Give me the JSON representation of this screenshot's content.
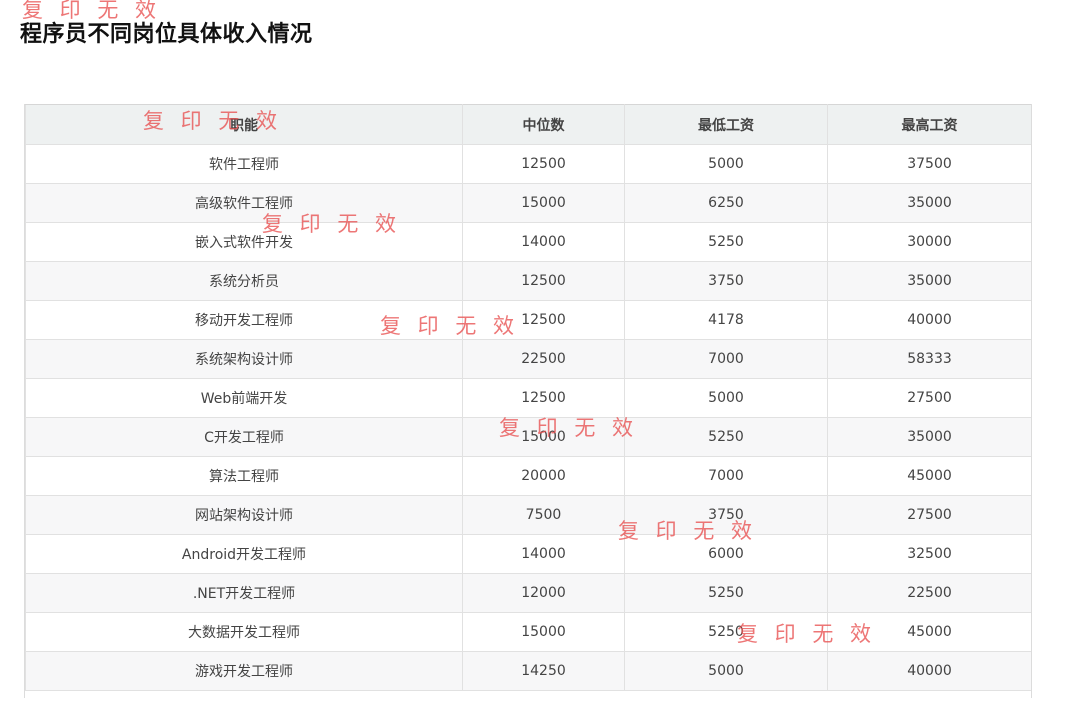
{
  "title": "程序员不同岗位具体收入情况",
  "watermark": "复 印 无 效",
  "table": {
    "headers": [
      "职能",
      "中位数",
      "最低工资",
      "最高工资"
    ],
    "rows": [
      [
        "软件工程师",
        "12500",
        "5000",
        "37500"
      ],
      [
        "高级软件工程师",
        "15000",
        "6250",
        "35000"
      ],
      [
        "嵌入式软件开发",
        "14000",
        "5250",
        "30000"
      ],
      [
        "系统分析员",
        "12500",
        "3750",
        "35000"
      ],
      [
        "移动开发工程师",
        "12500",
        "4178",
        "40000"
      ],
      [
        "系统架构设计师",
        "22500",
        "7000",
        "58333"
      ],
      [
        "Web前端开发",
        "12500",
        "5000",
        "27500"
      ],
      [
        "C开发工程师",
        "15000",
        "5250",
        "35000"
      ],
      [
        "算法工程师",
        "20000",
        "7000",
        "45000"
      ],
      [
        "网站架构设计师",
        "7500",
        "3750",
        "27500"
      ],
      [
        "Android开发工程师",
        "14000",
        "6000",
        "32500"
      ],
      [
        ".NET开发工程师",
        "12000",
        "5250",
        "22500"
      ],
      [
        "大数据开发工程师",
        "15000",
        "5250",
        "45000"
      ],
      [
        "游戏开发工程师",
        "14250",
        "5000",
        "40000"
      ]
    ]
  }
}
